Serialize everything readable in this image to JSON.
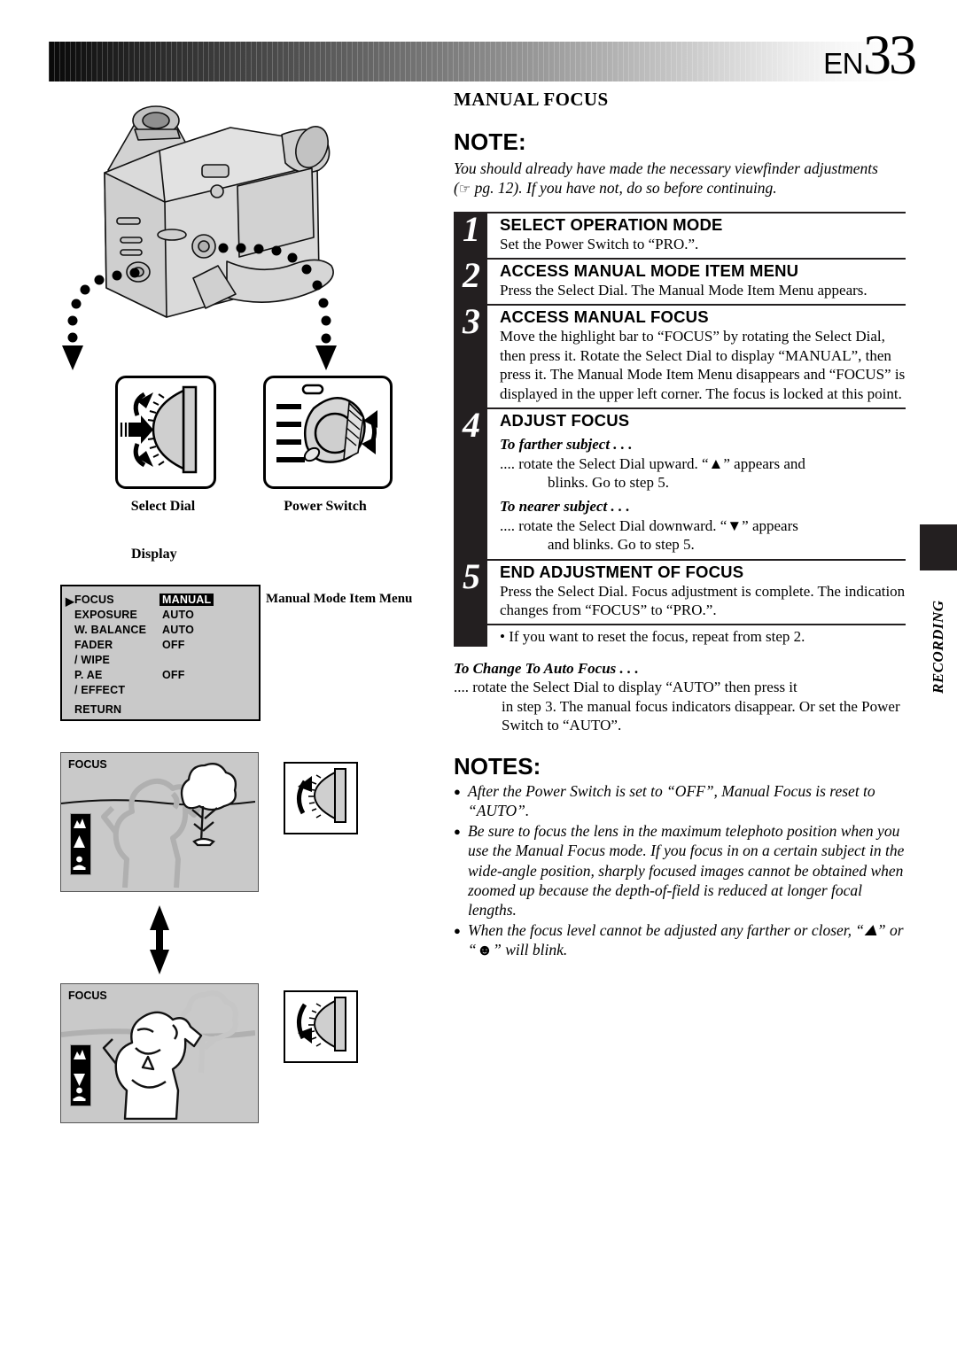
{
  "header": {
    "lang_code": "EN",
    "page_number": "33"
  },
  "side_tab": {
    "label": "RECORDING"
  },
  "left": {
    "select_dial_caption": "Select Dial",
    "power_switch_caption": "Power Switch",
    "display_caption": "Display",
    "menu_note": "Manual Mode Item Menu",
    "menu": {
      "cursor": "▶",
      "rows": [
        {
          "label": "FOCUS",
          "value": "MANUAL",
          "highlight": true,
          "cursor": true
        },
        {
          "label": "EXPOSURE",
          "value": "AUTO",
          "highlight": false,
          "cursor": false
        },
        {
          "label": "W. BALANCE",
          "value": "AUTO",
          "highlight": false,
          "cursor": false
        },
        {
          "label": "FADER",
          "value": "OFF",
          "highlight": false,
          "cursor": false
        },
        {
          "label": " / WIPE",
          "value": "",
          "highlight": false,
          "cursor": false
        },
        {
          "label": "P. AE",
          "value": "OFF",
          "highlight": false,
          "cursor": false
        },
        {
          "label": " / EFFECT",
          "value": "",
          "highlight": false,
          "cursor": false
        },
        {
          "label": "RETURN",
          "value": "",
          "highlight": false,
          "cursor": false
        }
      ]
    },
    "viewfinder_far": {
      "label": "FOCUS"
    },
    "viewfinder_near": {
      "label": "FOCUS"
    }
  },
  "right": {
    "section_title": "MANUAL FOCUS",
    "note_heading": "NOTE:",
    "note_body_1": "You should already have made the necessary viewfinder adjustments (",
    "note_ref": "pg. 12",
    "note_body_2": "). If you have not, do so before continuing.",
    "steps": [
      {
        "num": "1",
        "title": "SELECT OPERATION MODE",
        "body": "Set the Power Switch to “PRO.”."
      },
      {
        "num": "2",
        "title": "ACCESS MANUAL MODE ITEM MENU",
        "body": "Press the Select Dial. The Manual Mode Item Menu appears."
      },
      {
        "num": "3",
        "title": "ACCESS MANUAL FOCUS",
        "body": "Move the highlight bar to “FOCUS” by rotating the Select Dial, then press it. Rotate the Select Dial to display “MANUAL”, then press it. The Manual Mode Item Menu disappears and “FOCUS” is displayed in the upper left corner. The focus is locked at this point."
      },
      {
        "num": "4",
        "title": "ADJUST FOCUS",
        "sub_a_heading": "To farther subject . . .",
        "sub_a_line1": ".... rotate the Select Dial upward. “▲” appears and",
        "sub_a_line2": "blinks. Go to step 5.",
        "sub_b_heading": "To nearer subject . . .",
        "sub_b_line1": ".... rotate the Select Dial downward. “▼” appears",
        "sub_b_line2": "and blinks. Go to step 5."
      },
      {
        "num": "5",
        "title": "END ADJUSTMENT OF FOCUS",
        "body": "Press the Select Dial. Focus adjustment is complete. The indication changes from “FOCUS” to “PRO.”."
      }
    ],
    "reset_bullet": "• If you want to reset the focus, repeat from step 2.",
    "auto_focus_heading": "To Change To Auto Focus . . .",
    "auto_focus_line1": ".... rotate the Select Dial to display “AUTO” then press it",
    "auto_focus_line2": "in step 3. The manual focus indicators disappear. Or set the Power Switch to “AUTO”.",
    "notes_heading": "NOTES:",
    "notes": [
      "After the Power Switch is set to “OFF”, Manual Focus is reset to “AUTO”.",
      "Be sure to focus the lens in the maximum telephoto position when you use the Manual Focus mode. If you focus in on a certain subject in the wide-angle position, sharply focused images cannot be obtained when zoomed up because the depth-of-field is reduced at longer focal lengths.",
      "When the focus level cannot be adjusted any farther or closer, “⛰” or “☻” will blink."
    ]
  },
  "colors": {
    "ink": "#231f20",
    "screen_gray": "#c9c9c9",
    "illustration_gray": "#d4d4d4"
  }
}
